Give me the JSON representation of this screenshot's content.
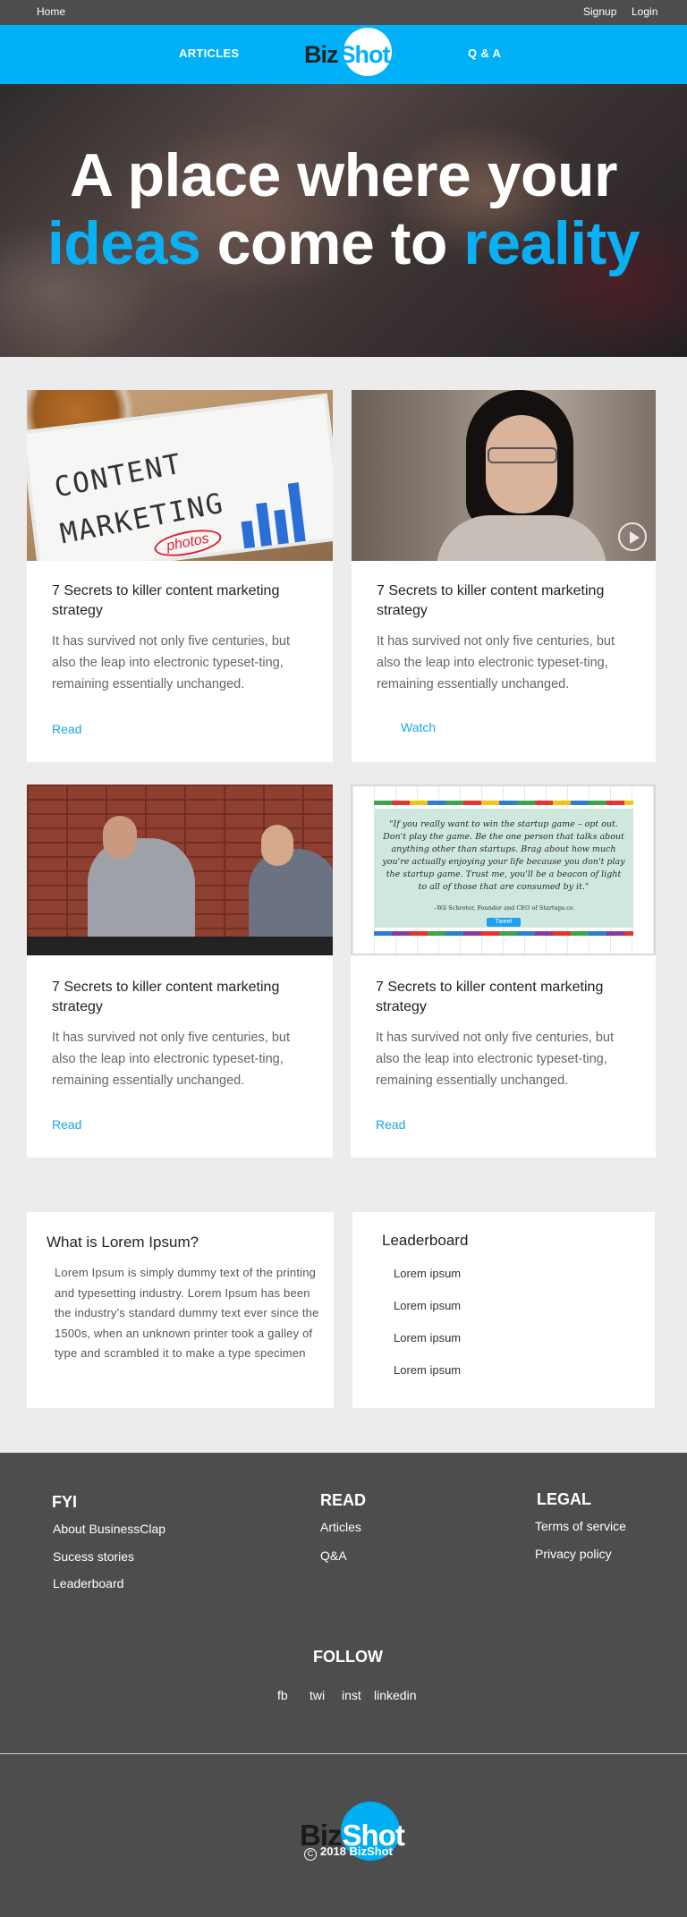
{
  "topbar": {
    "home": "Home",
    "signup": "Signup",
    "login": "Login"
  },
  "nav": {
    "articles": "ARTICLES",
    "qa": "Q & A"
  },
  "logo": {
    "biz": "Biz",
    "shot": "Shot"
  },
  "hero": {
    "line1": "A place where your",
    "line2_a": "ideas",
    "line2_b": " come to ",
    "line2_c": "reality"
  },
  "cards": [
    {
      "title": "7 Secrets to killer content marketing strategy",
      "desc": "It has survived not only five centuries, but also the leap into electronic typeset-ting, remaining essentially unchanged.",
      "action": "Read",
      "image_words": [
        "CONTENT",
        "MARKETING",
        "photos"
      ]
    },
    {
      "title": "7 Secrets to killer content marketing strategy",
      "desc": "It has survived not only five centuries, but also the leap into electronic typeset-ting, remaining essentially unchanged.",
      "action": "Watch"
    },
    {
      "title": "7 Secrets to killer content marketing strategy",
      "desc": "It has survived not only five centuries, but also the leap into electronic typeset-ting, remaining essentially unchanged.",
      "action": "Read"
    },
    {
      "title": "7 Secrets to killer content marketing strategy",
      "desc": "It has survived not only five centuries, but also the leap into electronic typeset-ting, remaining essentially unchanged.",
      "action": "Read",
      "image_quote": "\"If you really want to win the startup game – opt out. Don't play the game. Be the one person that talks about anything other than startups. Brag about how much you're actually enjoying your life because you don't play the startup game. Trust me, you'll be a beacon of light to all of those that are consumed by it.\"",
      "image_attribution": "–Wil Schroter, Founder and CEO of Startups.co",
      "image_tweet": "Tweet"
    }
  ],
  "lorem_box": {
    "heading": "What is Lorem Ipsum?",
    "text": "Lorem Ipsum is simply dummy text of the printing and typesetting industry. Lorem Ipsum has been the industry's standard dummy text ever since the 1500s, when an unknown printer took a galley of type and scrambled it to make a type specimen"
  },
  "leaderboard": {
    "heading": "Leaderboard",
    "items": [
      "Lorem ipsum",
      "Lorem ipsum",
      "Lorem ipsum",
      "Lorem ipsum"
    ]
  },
  "footer": {
    "fyi": {
      "heading": "FYI",
      "links": [
        "About BusinessClap",
        "Sucess stories",
        "Leaderboard"
      ]
    },
    "read": {
      "heading": "READ",
      "links": [
        "Articles",
        "Q&A"
      ]
    },
    "legal": {
      "heading": "LEGAL",
      "links": [
        "Terms of service",
        "Privacy policy"
      ]
    },
    "follow": {
      "heading": "FOLLOW",
      "links": [
        "fb",
        "twi",
        "inst",
        "linkedin"
      ]
    },
    "copyright_symbol": "C",
    "copyright": "2018 BizShot"
  },
  "colors": {
    "brand_blue": "#00b0f8",
    "dark_bar": "#4d4d4d",
    "link_blue": "#1aa5e6",
    "page_bg": "#ececec"
  }
}
